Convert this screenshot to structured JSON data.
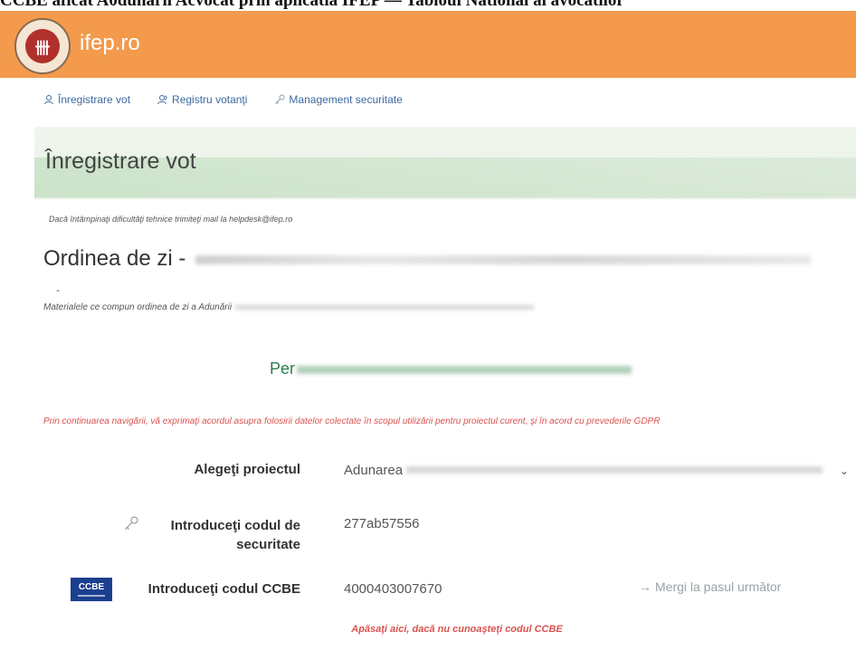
{
  "caption": "CCBE aflcat A0dunarii Acvocat prin aplicatia IFEP — Tabloul National al avocatilor",
  "brand": {
    "site_name": "ifep.ro",
    "logo_center": "卌"
  },
  "nav": {
    "items": [
      {
        "label": "Înregistrare vot",
        "icon": "user-icon"
      },
      {
        "label": "Registru votanţi",
        "icon": "users-icon"
      },
      {
        "label": "Management securitate",
        "icon": "key-icon"
      }
    ]
  },
  "page": {
    "title": "Înregistrare vot",
    "helpdesk": "Dacă întâmpinaţi dificultăţi tehnice trimiteţi mail la helpdesk@ifep.ro",
    "agenda_prefix": "Ordinea de zi - ",
    "agenda_dash": "-",
    "materials": "Materialele ce compun ordinea de zi a Adunării",
    "period_prefix": "Per",
    "gdpr": "Prin continuarea navigării, vă exprimaţi acordul asupra folosirii datelor colectate în scopul utilizării pentru proiectul curent, şi în acord cu prevederile GDPR"
  },
  "form": {
    "project_label": "Alegeţi proiectul",
    "project_value": "Adunarea",
    "security_label": "Introduceţi codul de securitate",
    "security_value": "277ab57556",
    "ccbe_label": "Introduceţi codul CCBE",
    "ccbe_badge": "CCBE",
    "ccbe_value": "4000403007670",
    "next_button": "Mergi la pasul următor",
    "unknown_code_link": "Apăsaţi aici, dacă nu cunoaşteţi codul CCBE"
  },
  "colors": {
    "brand_orange": "#f39a4c",
    "link_blue": "#3b6aa0",
    "period_green": "#2e7d4b",
    "warning_red": "#d9534f",
    "ccbe_blue": "#1b3f8f"
  }
}
